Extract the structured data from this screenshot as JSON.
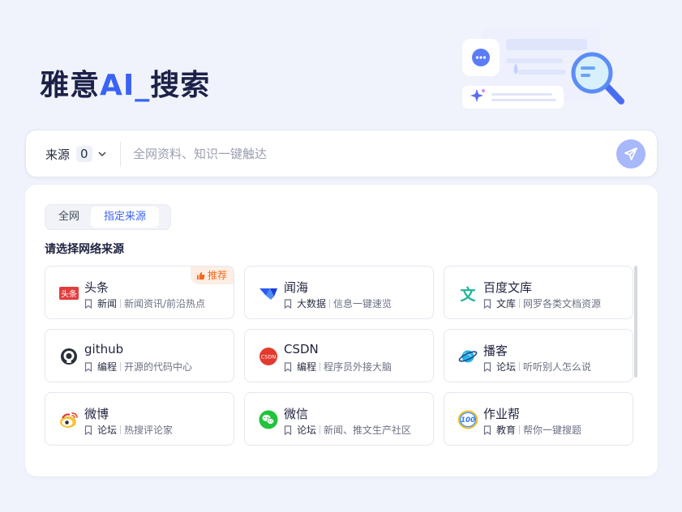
{
  "header": {
    "title_prefix": "雅意",
    "title_ai": "AI",
    "title_underscore": "_",
    "title_suffix": "搜索"
  },
  "search": {
    "source_label": "来源",
    "source_count": "0",
    "placeholder": "全网资料、知识一键触达",
    "value": ""
  },
  "panel": {
    "tabs": [
      {
        "label": "全网",
        "active": false
      },
      {
        "label": "指定来源",
        "active": true
      }
    ],
    "section_title": "请选择网络来源",
    "badge_label": "推荐",
    "sources": [
      {
        "name": "头条",
        "category": "新闻",
        "desc": "新闻资讯/前沿热点",
        "icon": "toutiao-logo-icon"
      },
      {
        "name": "闻海",
        "category": "大数据",
        "desc": "信息一键速览",
        "icon": "wenhai-logo-icon"
      },
      {
        "name": "百度文库",
        "category": "文库",
        "desc": "网罗各类文档资源",
        "icon": "baidu-wenku-logo-icon"
      },
      {
        "name": "github",
        "category": "编程",
        "desc": "开源的代码中心",
        "icon": "github-logo-icon"
      },
      {
        "name": "CSDN",
        "category": "编程",
        "desc": "程序员外接大脑",
        "icon": "csdn-logo-icon"
      },
      {
        "name": "播客",
        "category": "论坛",
        "desc": "听听别人怎么说",
        "icon": "podcast-planet-icon"
      },
      {
        "name": "微博",
        "category": "论坛",
        "desc": "热搜评论家",
        "icon": "weibo-logo-icon"
      },
      {
        "name": "微信",
        "category": "论坛",
        "desc": "新闻、推文生产社区",
        "icon": "wechat-logo-icon"
      },
      {
        "name": "作业帮",
        "category": "教育",
        "desc": "帮你一键搜题",
        "icon": "zuoyebang-logo-icon"
      }
    ],
    "logo_text": {
      "toutiao": "头条",
      "csdn": "CSDN",
      "wenku": "文",
      "zuoyebang": "100"
    }
  },
  "colors": {
    "brand": "#3a63f6",
    "send_button": "#a7b8fb",
    "badge_bg": "#fdeee3",
    "badge_text": "#f06a1d"
  }
}
